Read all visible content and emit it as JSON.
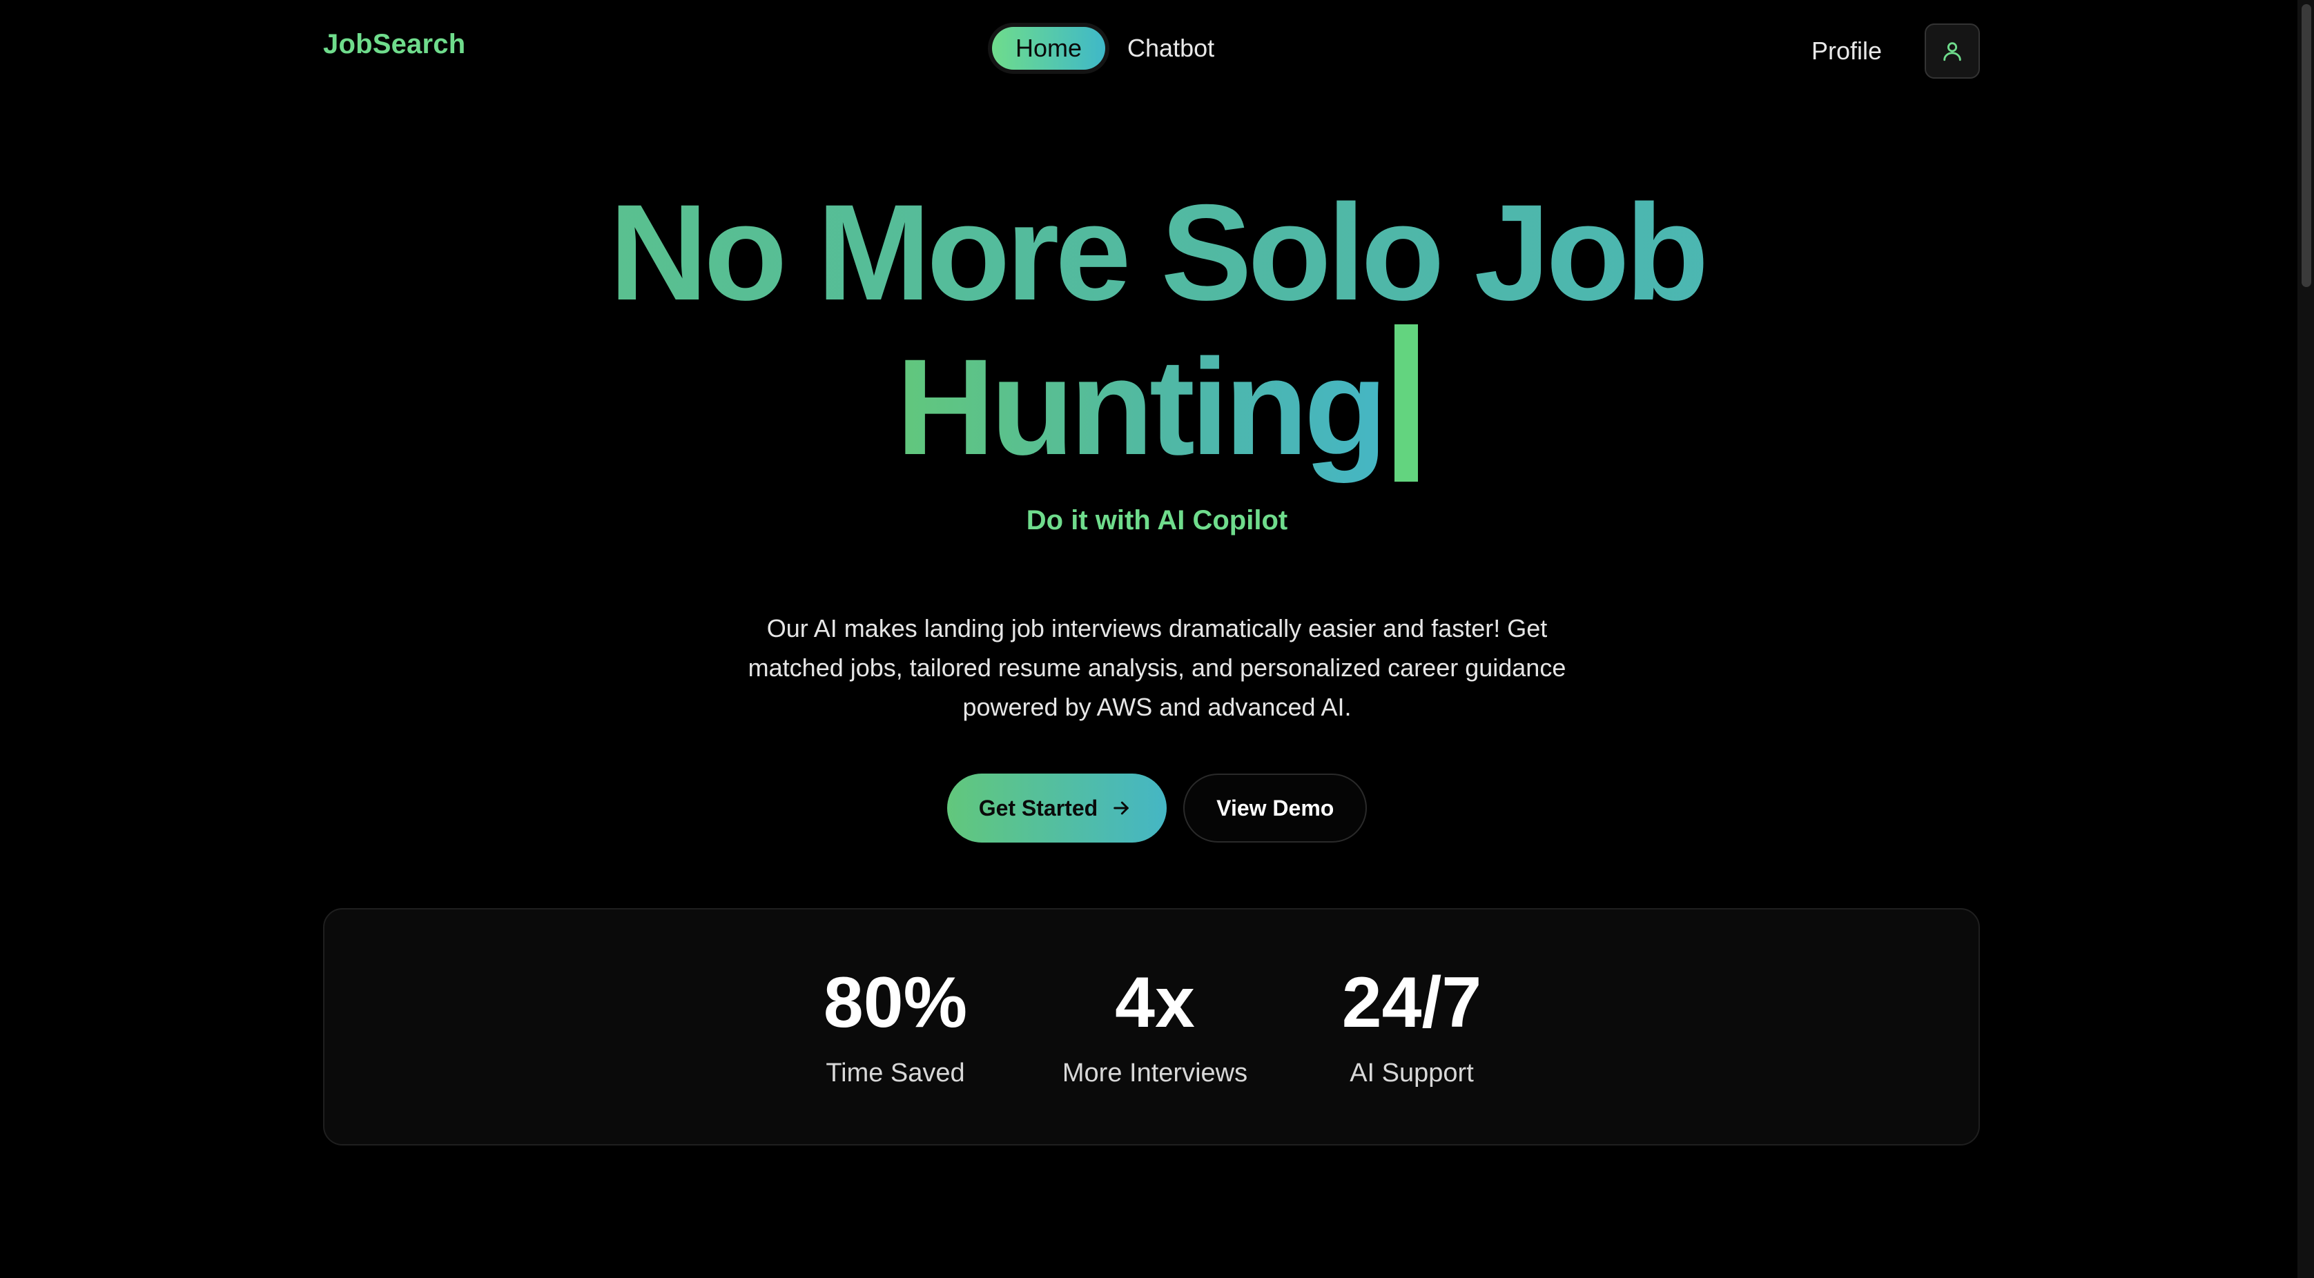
{
  "nav": {
    "brand": "JobSearch",
    "links": [
      {
        "label": "Home",
        "active": true
      },
      {
        "label": "Chatbot",
        "active": false
      }
    ],
    "profile_label": "Profile",
    "profile_icon": "user-icon"
  },
  "hero": {
    "title_line1": "No More Solo Job",
    "title_line2": "Hunting",
    "tagline": "Do it with AI Copilot",
    "description": "Our AI makes landing job interviews dramatically easier and faster! Get matched jobs, tailored resume analysis, and personalized career guidance powered by AWS and advanced AI.",
    "primary_cta": "Get Started",
    "primary_cta_icon": "arrow-right-icon",
    "secondary_cta": "View Demo"
  },
  "stats": [
    {
      "value": "80%",
      "label": "Time Saved"
    },
    {
      "value": "4x",
      "label": "More Interviews"
    },
    {
      "value": "24/7",
      "label": "AI Support"
    }
  ],
  "colors": {
    "accent_green": "#6fdc8c",
    "accent_teal": "#45b6c4",
    "background": "#000000",
    "card": "#0a0a0a"
  }
}
